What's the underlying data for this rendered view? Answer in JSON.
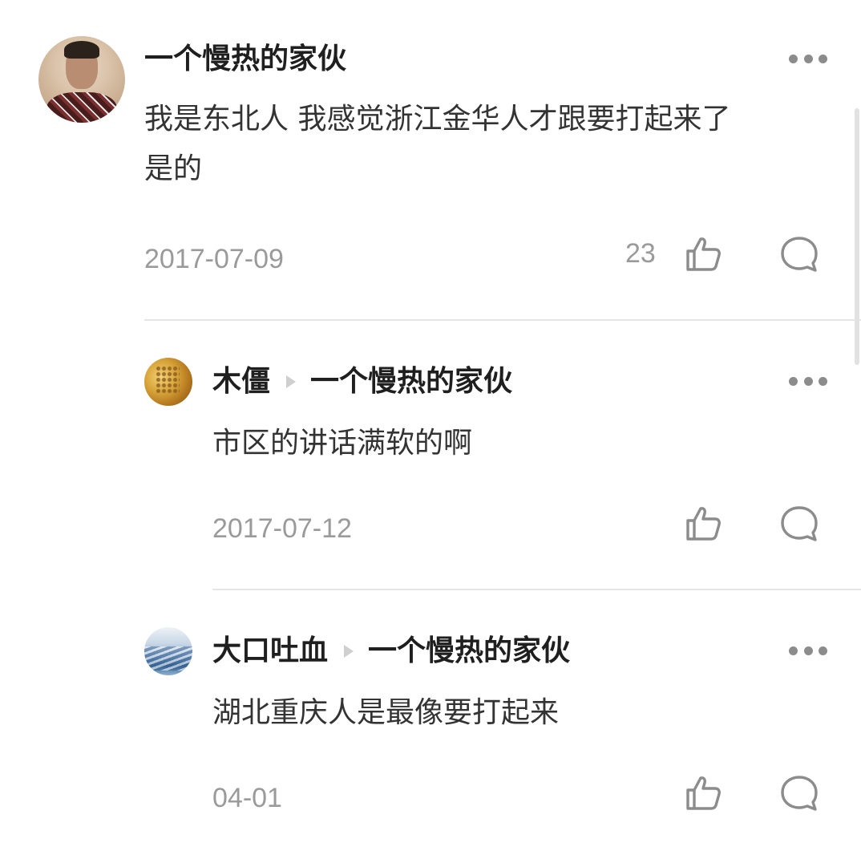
{
  "comment": {
    "author": "一个慢热的家伙",
    "avatar_icon": "user-avatar-man",
    "text_line1": "我是东北人 我感觉浙江金华人才跟要打起来了",
    "text_line2": "是的",
    "date": "2017-07-09",
    "like_count": "23"
  },
  "replies": [
    {
      "author": "木僵",
      "reply_to": "一个慢热的家伙",
      "avatar_icon": "user-avatar-gold",
      "text": "市区的讲话满软的啊",
      "date": "2017-07-12"
    },
    {
      "author": "大口吐血",
      "reply_to": "一个慢热的家伙",
      "avatar_icon": "user-avatar-blue",
      "text": "湖北重庆人是最像要打起来",
      "date": "04-01"
    }
  ],
  "icons": {
    "like": "thumbs-up-icon",
    "reply": "comment-bubble-icon",
    "more": "more-dots-icon"
  },
  "colors": {
    "name": "#1f1f1f",
    "text": "#333333",
    "meta": "#9a9a9a",
    "icon": "#8c8c8c",
    "divider": "#e5e5e5"
  }
}
